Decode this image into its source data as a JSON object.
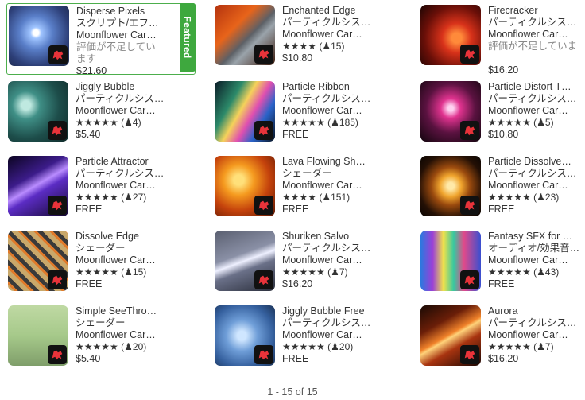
{
  "items": [
    {
      "title": "Disperse Pixels",
      "category": "スクリプト/エフ…",
      "publisher": "Moonflower Car…",
      "no_rating": "評価が不足しています",
      "price": "$21.60",
      "featured": true,
      "art": "a0"
    },
    {
      "title": "Enchanted Edge",
      "category": "パーティクルシス…",
      "publisher": "Moonflower Car…",
      "stars": "★★★★",
      "count": "(♟15)",
      "price": "$10.80",
      "art": "a1"
    },
    {
      "title": "Firecracker",
      "category": "パーティクルシス…",
      "publisher": "Moonflower Car…",
      "no_rating": "評価が不足していま",
      "price": "$16.20",
      "art": "a2"
    },
    {
      "title": "Jiggly Bubble",
      "category": "パーティクルシス…",
      "publisher": "Moonflower Car…",
      "stars": "★★★★★",
      "count": "(♟4)",
      "price": "$5.40",
      "art": "a3"
    },
    {
      "title": "Particle Ribbon",
      "category": "パーティクルシス…",
      "publisher": "Moonflower Car…",
      "stars": "★★★★★",
      "count": "(♟185)",
      "price": "FREE",
      "art": "a4"
    },
    {
      "title": "Particle Distort T…",
      "category": "パーティクルシス…",
      "publisher": "Moonflower Car…",
      "stars": "★★★★★",
      "count": "(♟5)",
      "price": "$10.80",
      "art": "a5"
    },
    {
      "title": "Particle Attractor",
      "category": "パーティクルシス…",
      "publisher": "Moonflower Car…",
      "stars": "★★★★★",
      "count": "(♟27)",
      "price": "FREE",
      "art": "a6"
    },
    {
      "title": "Lava Flowing Sh…",
      "category": "シェーダー",
      "publisher": "Moonflower Car…",
      "stars": "★★★★",
      "count": "(♟151)",
      "price": "FREE",
      "art": "a7"
    },
    {
      "title": "Particle Dissolve…",
      "category": "パーティクルシス…",
      "publisher": "Moonflower Car…",
      "stars": "★★★★★",
      "count": "(♟23)",
      "price": "FREE",
      "art": "a8"
    },
    {
      "title": "Dissolve Edge",
      "category": "シェーダー",
      "publisher": "Moonflower Car…",
      "stars": "★★★★★",
      "count": "(♟15)",
      "price": "FREE",
      "art": "a9"
    },
    {
      "title": "Shuriken Salvo",
      "category": "パーティクルシス…",
      "publisher": "Moonflower Car…",
      "stars": "★★★★★",
      "count": "(♟7)",
      "price": "$16.20",
      "art": "a10"
    },
    {
      "title": "Fantasy SFX for …",
      "category": "オーディオ/効果音…",
      "publisher": "Moonflower Car…",
      "stars": "★★★★★",
      "count": "(♟43)",
      "price": "FREE",
      "art": "a11"
    },
    {
      "title": "Simple SeeThro…",
      "category": "シェーダー",
      "publisher": "Moonflower Car…",
      "stars": "★★★★★",
      "count": "(♟20)",
      "price": "$5.40",
      "art": "a12"
    },
    {
      "title": "Jiggly Bubble Free",
      "category": "パーティクルシス…",
      "publisher": "Moonflower Car…",
      "stars": "★★★★★",
      "count": "(♟20)",
      "price": "FREE",
      "art": "a13"
    },
    {
      "title": "Aurora",
      "category": "パーティクルシス…",
      "publisher": "Moonflower Car…",
      "stars": "★★★★★",
      "count": "(♟7)",
      "price": "$16.20",
      "art": "a14"
    }
  ],
  "featured_label": "Featured",
  "pagination": "1 - 15 of 15",
  "colors": {
    "featured_green": "#3ea83e"
  },
  "icons": {
    "publisher_badge": "moonflower-dragon-icon"
  }
}
